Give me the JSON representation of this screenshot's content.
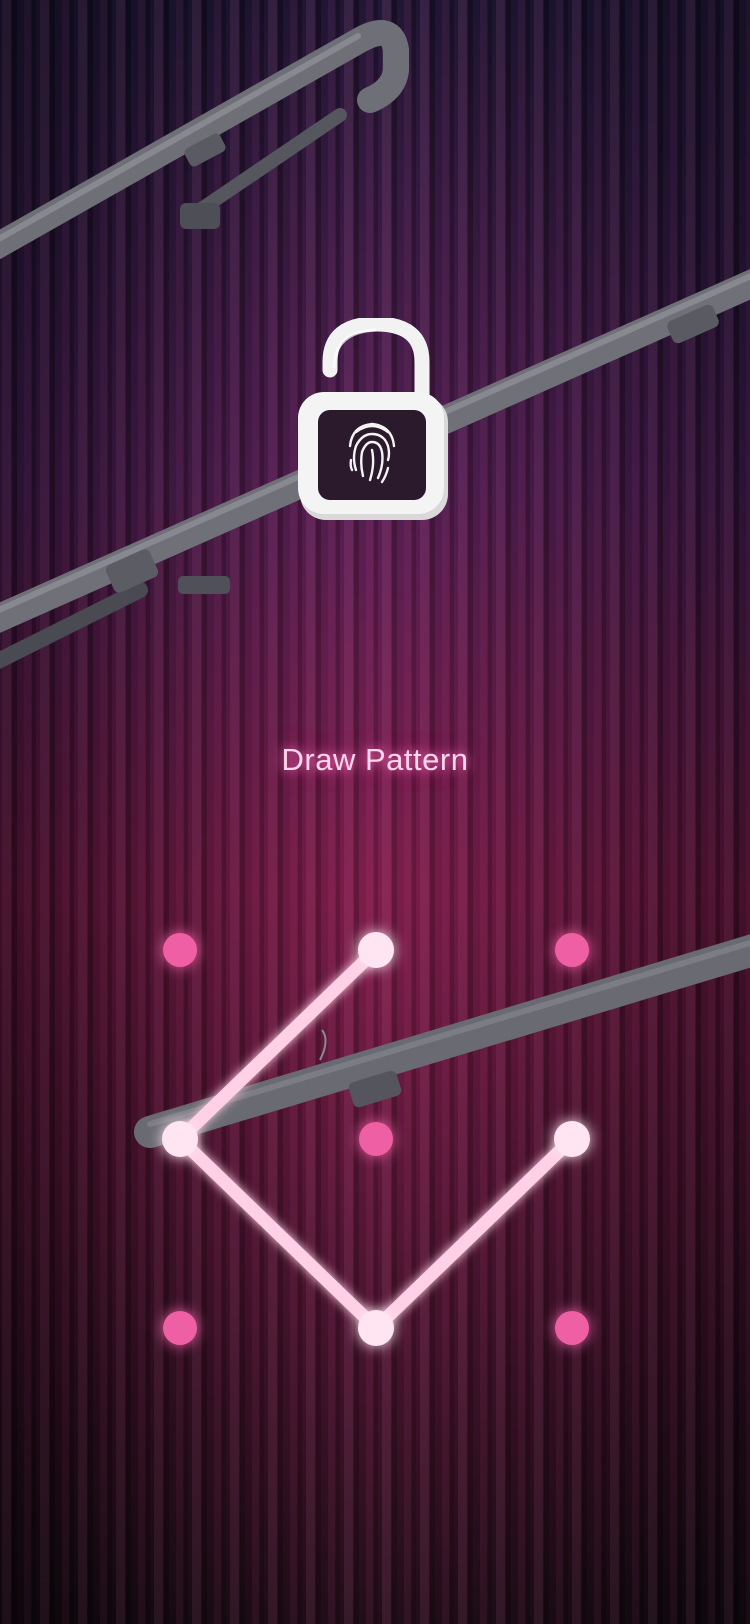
{
  "prompt": {
    "text": "Draw Pattern"
  },
  "icon": {
    "lock": "unlocked-padlock-fingerprint-icon"
  },
  "pattern": {
    "grid_size": 3,
    "selected_sequence": [
      2,
      4,
      8,
      6
    ],
    "colors": {
      "dot_idle": "#ef5fa4",
      "dot_active": "#ffe4f1",
      "line": "#ffd0e6",
      "glow": "#ff4fa8"
    }
  },
  "colors": {
    "background_top": "#1d1634",
    "background_mid": "#5a1438",
    "background_bottom": "#140b12",
    "lock": "#f2f2f2"
  }
}
